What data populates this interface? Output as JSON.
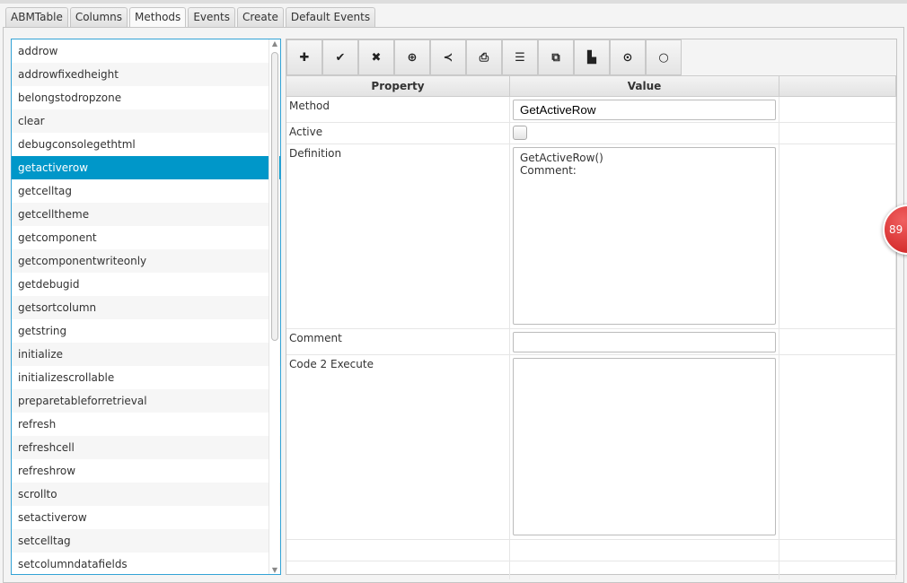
{
  "tabs": [
    "ABMTable",
    "Columns",
    "Methods",
    "Events",
    "Create",
    "Default Events"
  ],
  "active_tab": "Methods",
  "methods": [
    "addrow",
    "addrowfixedheight",
    "belongstodropzone",
    "clear",
    "debugconsolegethtml",
    "getactiverow",
    "getcelltag",
    "getcelltheme",
    "getcomponent",
    "getcomponentwriteonly",
    "getdebugid",
    "getsortcolumn",
    "getstring",
    "initialize",
    "initializescrollable",
    "preparetableforretrieval",
    "refresh",
    "refreshcell",
    "refreshrow",
    "scrollto",
    "setactiverow",
    "setcelltag",
    "setcolumndatafields"
  ],
  "selected_method": "getactiverow",
  "toolbar": [
    {
      "icon": "plus-icon",
      "glyph": "✚"
    },
    {
      "icon": "check-icon",
      "glyph": "✔"
    },
    {
      "icon": "times-icon",
      "glyph": "✖"
    },
    {
      "icon": "plus-circle-icon",
      "glyph": "⊕"
    },
    {
      "icon": "share-icon",
      "glyph": "≺"
    },
    {
      "icon": "print-icon",
      "glyph": "⎙"
    },
    {
      "icon": "list-icon",
      "glyph": "☰"
    },
    {
      "icon": "copy-icon",
      "glyph": "⧉"
    },
    {
      "icon": "paste-icon",
      "glyph": "▙"
    },
    {
      "icon": "dot-circle-icon",
      "glyph": "⊙"
    },
    {
      "icon": "circle-icon",
      "glyph": "○"
    }
  ],
  "grid": {
    "header": {
      "property": "Property",
      "value": "Value"
    },
    "method_label": "Method",
    "method_value": "GetActiveRow",
    "active_label": "Active",
    "definition_label": "Definition",
    "definition_value": "GetActiveRow()\nComment:",
    "comment_label": "Comment",
    "comment_value": "",
    "code_label": "Code 2 Execute",
    "code_value": ""
  },
  "badge": "89"
}
